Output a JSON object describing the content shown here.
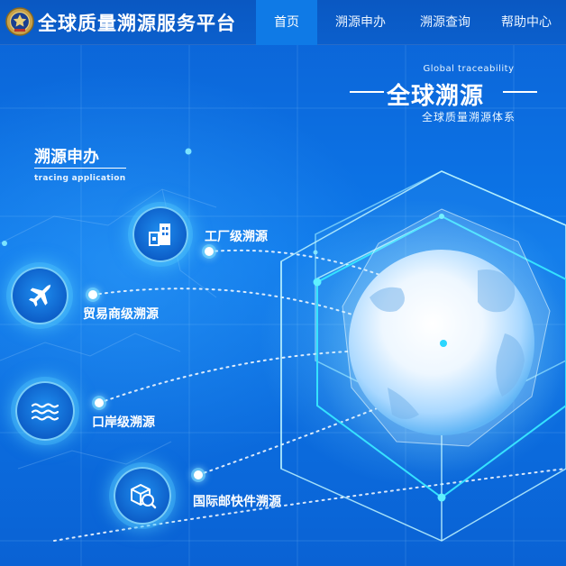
{
  "header": {
    "site_title": "全球质量溯源服务平台",
    "nav": [
      {
        "label": "首页",
        "active": true
      },
      {
        "label": "溯源申办",
        "active": false
      },
      {
        "label": "溯源查询",
        "active": false
      },
      {
        "label": "帮助中心",
        "active": false
      }
    ]
  },
  "hero": {
    "slogan_en": "Global traceability",
    "slogan_title": "全球溯源",
    "slogan_sub": "全球质量溯源体系"
  },
  "section": {
    "title": "溯源申办",
    "subtitle": "tracing application"
  },
  "trace_items": [
    {
      "label": "工厂级溯源",
      "icon": "factory-icon"
    },
    {
      "label": "贸易商级溯源",
      "icon": "airplane-icon"
    },
    {
      "label": "口岸级溯源",
      "icon": "waves-icon"
    },
    {
      "label": "国际邮快件溯源",
      "icon": "package-search-icon"
    }
  ],
  "colors": {
    "background": "#0a66d8",
    "header": "#0a58c2",
    "nav_active": "#0f7ae6",
    "glow": "#5ad2ff"
  }
}
